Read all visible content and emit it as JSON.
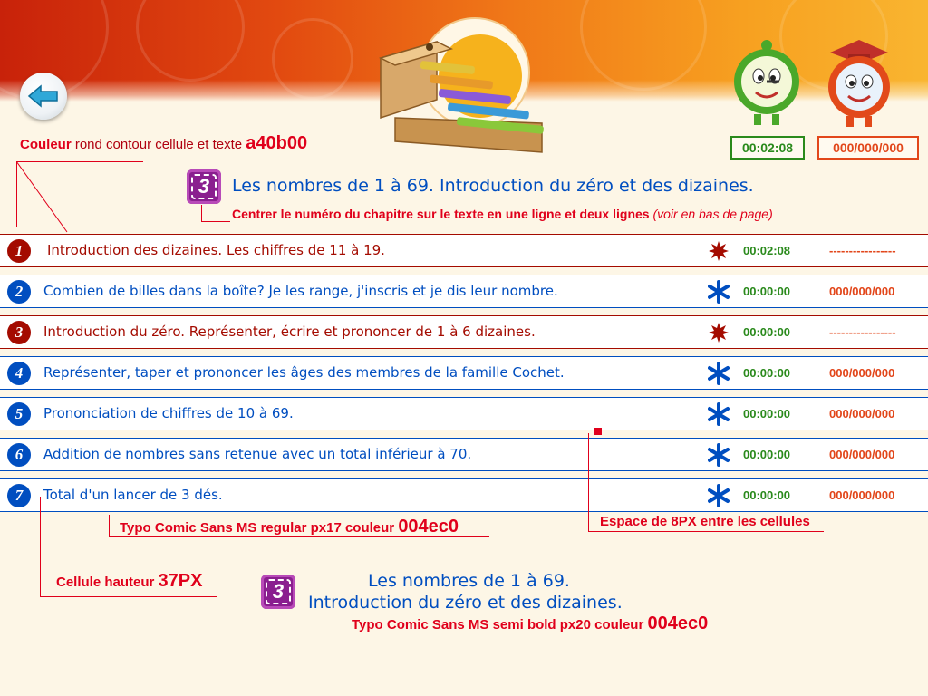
{
  "header": {
    "timer": "00:02:08",
    "score": "000/000/000"
  },
  "annotations": {
    "cell_color_a": "Couleur",
    "cell_color_b": " rond  contour cellule et texte ",
    "cell_color_code": "a40b00",
    "center_a": "Centrer",
    "center_b": " le numéro du chapitre sur le texte en une ligne et deux lignes ",
    "center_c": "(voir en bas de page)",
    "font_regular": "Typo Comic Sans MS regular px17 couleur ",
    "font_regular_code": "004ec0",
    "spacing": "Espace de 8PX entre les cellules",
    "cell_height_a": "Cellule hauteur ",
    "cell_height_code": "37PX",
    "font_semibold": "Typo Comic Sans MS semi bold px20 couleur ",
    "font_semibold_code": "004ec0"
  },
  "chapter": {
    "number": "3",
    "title": "Les nombres de 1 à 69. Introduction du zéro et des dizaines.",
    "title_line1": "Les nombres de 1 à 69.",
    "title_line2": "Introduction du zéro et des dizaines."
  },
  "lessons": [
    {
      "number": "1",
      "text": "Introduction des dizaines. Les chiffres de 11 à 19.",
      "time": "00:02:08",
      "score": "-----------------",
      "status": "red-splat-icon"
    },
    {
      "number": "2",
      "text": "Combien de billes dans la boîte? Je les range, j'inscris et je dis leur nombre.",
      "time": "00:00:00",
      "score": "000/000/000",
      "status": "blue-asterisk-icon"
    },
    {
      "number": "3",
      "text": "Introduction du zéro. Représenter, écrire et prononcer de 1 à 6 dizaines.",
      "time": "00:00:00",
      "score": "-----------------",
      "status": "red-splat-icon"
    },
    {
      "number": "4",
      "text": "Représenter, taper et prononcer les âges des membres de la famille Cochet.",
      "time": "00:00:00",
      "score": "000/000/000",
      "status": "blue-asterisk-icon"
    },
    {
      "number": "5",
      "text": "Prononciation de chiffres de 10 à 69.",
      "time": "00:00:00",
      "score": "000/000/000",
      "status": "blue-asterisk-icon"
    },
    {
      "number": "6",
      "text": "Addition de nombres sans retenue avec un total inférieur à 70.",
      "time": "00:00:00",
      "score": "000/000/000",
      "status": "blue-asterisk-icon"
    },
    {
      "number": "7",
      "text": "Total d'un lancer de 3 dés.",
      "time": "00:00:00",
      "score": "000/000/000",
      "status": "blue-asterisk-icon"
    }
  ],
  "colors": {
    "red": "#a40b00",
    "blue": "#004ec0",
    "annotation": "#e0001b",
    "timer_green": "#2a8a1c",
    "score_orange": "#e2461a"
  }
}
